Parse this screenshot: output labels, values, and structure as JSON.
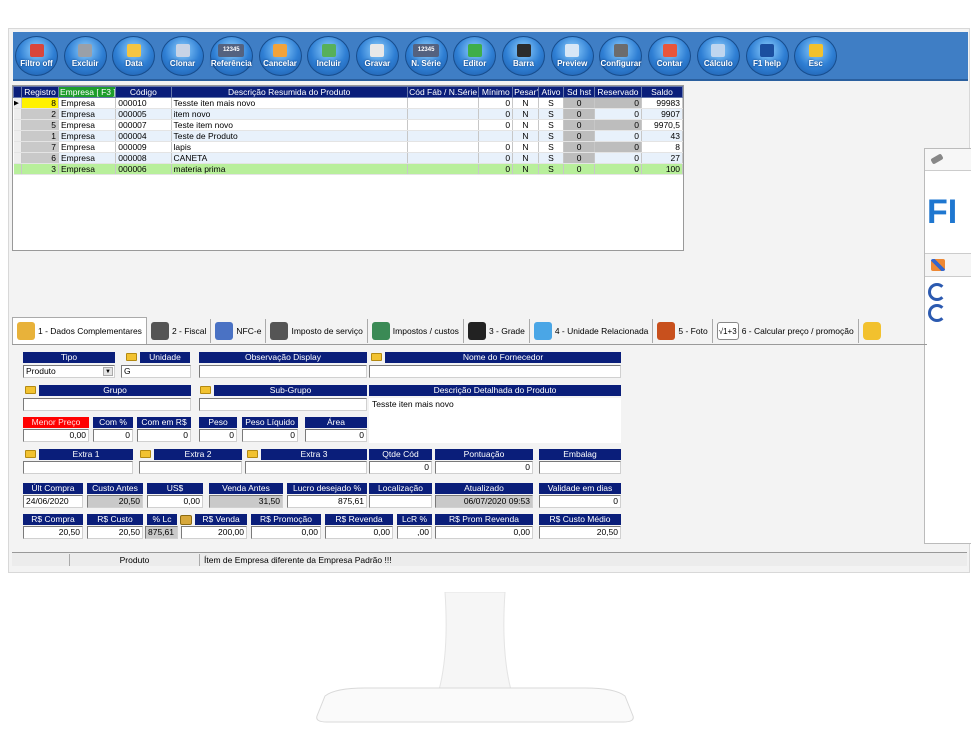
{
  "toolbar": {
    "buttons": [
      {
        "label": "Filtro off",
        "icon": "filter-icon"
      },
      {
        "label": "Excluir",
        "icon": "trash-icon"
      },
      {
        "label": "Data",
        "icon": "calendar-icon"
      },
      {
        "label": "Clonar",
        "icon": "clone-icon"
      },
      {
        "label": "Referência",
        "icon": "barcode-number-icon"
      },
      {
        "label": "Cancelar",
        "icon": "undo-icon"
      },
      {
        "label": "Incluir",
        "icon": "add-check-icon"
      },
      {
        "label": "Gravar",
        "icon": "save-icon"
      },
      {
        "label": "N. Série",
        "icon": "serial-number-icon"
      },
      {
        "label": "Editor",
        "icon": "pencil-icon"
      },
      {
        "label": "Barra",
        "icon": "barcode-icon"
      },
      {
        "label": "Preview",
        "icon": "printer-icon"
      },
      {
        "label": "Configurar",
        "icon": "gear-icon"
      },
      {
        "label": "Contar",
        "icon": "count-icon"
      },
      {
        "label": "Cálculo",
        "icon": "calculator-icon"
      },
      {
        "label": "F1 help",
        "icon": "help-icon"
      },
      {
        "label": "Esc",
        "icon": "exit-runner-icon"
      }
    ],
    "icon_number_text": "12345"
  },
  "grid": {
    "columns": [
      "Registro",
      "Empresa [ F3 ]",
      "Código",
      "Descrição Resumida do Produto",
      "Cód Fáb / N.Série",
      "Mínimo",
      "Pesar?",
      "Ativo",
      "Sd hst",
      "Reservado",
      "Saldo"
    ],
    "rows": [
      {
        "registro": "8",
        "empresa": "Empresa",
        "codigo": "000010",
        "descricao": "Tesste iten mais novo",
        "codfab": "",
        "minimo": "0",
        "pesar": "N",
        "ativo": "S",
        "sdhst": "0",
        "reservado": "0",
        "saldo": "99983"
      },
      {
        "registro": "2",
        "empresa": "Empresa",
        "codigo": "000005",
        "descricao": "item novo",
        "codfab": "",
        "minimo": "0",
        "pesar": "N",
        "ativo": "S",
        "sdhst": "0",
        "reservado": "0",
        "saldo": "9907"
      },
      {
        "registro": "5",
        "empresa": "Empresa",
        "codigo": "000007",
        "descricao": "Teste item novo",
        "codfab": "",
        "minimo": "0",
        "pesar": "N",
        "ativo": "S",
        "sdhst": "0",
        "reservado": "0",
        "saldo": "9970,5"
      },
      {
        "registro": "1",
        "empresa": "Empresa",
        "codigo": "000004",
        "descricao": "Teste de Produto",
        "codfab": "",
        "minimo": "",
        "pesar": "N",
        "ativo": "S",
        "sdhst": "0",
        "reservado": "0",
        "saldo": "43"
      },
      {
        "registro": "7",
        "empresa": "Empresa",
        "codigo": "000009",
        "descricao": "lapis",
        "codfab": "",
        "minimo": "0",
        "pesar": "N",
        "ativo": "S",
        "sdhst": "0",
        "reservado": "0",
        "saldo": "8"
      },
      {
        "registro": "6",
        "empresa": "Empresa",
        "codigo": "000008",
        "descricao": "CANETA",
        "codfab": "",
        "minimo": "0",
        "pesar": "N",
        "ativo": "S",
        "sdhst": "0",
        "reservado": "0",
        "saldo": "27"
      },
      {
        "registro": "3",
        "empresa": "Empresa",
        "codigo": "000006",
        "descricao": "materia prima",
        "codfab": "",
        "minimo": "0",
        "pesar": "N",
        "ativo": "S",
        "sdhst": "0",
        "reservado": "0",
        "saldo": "100"
      }
    ]
  },
  "tabs": [
    {
      "label": "1 - Dados Complementares",
      "icon": "pencil-ruler-icon"
    },
    {
      "label": "2 - Fiscal",
      "icon": "gears-icon"
    },
    {
      "label": "NFC-e",
      "icon": "document-icon"
    },
    {
      "label": "Imposto de serviço",
      "icon": "gears-icon"
    },
    {
      "label": "Impostos / custos",
      "icon": "magnifier-icon"
    },
    {
      "label": "3 - Grade",
      "icon": "shirt-icon"
    },
    {
      "label": "4 - Unidade Relacionada",
      "icon": "colorful-icon"
    },
    {
      "label": "5 - Foto",
      "icon": "photo-icon"
    },
    {
      "label": "6 - Calcular preço / promoção",
      "icon": "sqrt-icon"
    }
  ],
  "sqrt_icon_text": "√1+3",
  "form": {
    "tipo": {
      "label": "Tipo",
      "value": "Produto"
    },
    "unidade": {
      "label": "Unidade",
      "value": "G"
    },
    "observacao": {
      "label": "Observação Display",
      "value": ""
    },
    "fornecedor": {
      "label": "Nome do Fornecedor",
      "value": ""
    },
    "grupo": {
      "label": "Grupo",
      "value": ""
    },
    "subgrupo": {
      "label": "Sub-Grupo",
      "value": ""
    },
    "descricao_detalhada": {
      "label": "Descrição Detalhada do Produto",
      "value": "Tesste iten mais novo"
    },
    "menor_preco": {
      "label": "Menor Preço",
      "value": "0,00"
    },
    "com_pct": {
      "label": "Com %",
      "value": "0"
    },
    "com_rs": {
      "label": "Com em R$",
      "value": "0"
    },
    "peso": {
      "label": "Peso",
      "value": "0"
    },
    "peso_liquido": {
      "label": "Peso Líquido",
      "value": "0"
    },
    "area": {
      "label": "Área",
      "value": "0"
    },
    "extra1": {
      "label": "Extra 1",
      "value": ""
    },
    "extra2": {
      "label": "Extra 2",
      "value": ""
    },
    "extra3": {
      "label": "Extra 3",
      "value": ""
    },
    "qtde_cod": {
      "label": "Qtde Cód",
      "value": "0"
    },
    "pontuacao": {
      "label": "Pontuação",
      "value": "0"
    },
    "embalag": {
      "label": "Embalag",
      "value": ""
    },
    "ult_compra": {
      "label": "Últ Compra",
      "value": "24/06/2020"
    },
    "custo_antes": {
      "label": "Custo Antes",
      "value": "20,50"
    },
    "us": {
      "label": "US$",
      "value": "0,00"
    },
    "venda_antes": {
      "label": "Venda Antes",
      "value": "31,50"
    },
    "lucro": {
      "label": "Lucro desejado %",
      "value": "875,61"
    },
    "localizacao": {
      "label": "Localização",
      "value": ""
    },
    "atualizado": {
      "label": "Atualizado",
      "value": "06/07/2020 09:53"
    },
    "validade": {
      "label": "Validade em dias",
      "value": "0"
    },
    "rs_compra": {
      "label": "R$ Compra",
      "value": "20,50"
    },
    "rs_custo": {
      "label": "R$ Custo",
      "value": "20,50"
    },
    "pct_lc": {
      "label": "% Lc",
      "value": "875,61"
    },
    "rs_venda": {
      "label": "R$ Venda",
      "value": "200,00"
    },
    "rs_promocao": {
      "label": "R$ Promoção",
      "value": "0,00"
    },
    "rs_revenda": {
      "label": "R$ Revenda",
      "value": "0,00"
    },
    "lcr_pct": {
      "label": "LcR %",
      "value": ",00"
    },
    "rs_prom_revenda": {
      "label": "R$ Prom Revenda",
      "value": "0,00"
    },
    "rs_custo_medio": {
      "label": "R$ Custo Médio",
      "value": "20,50"
    }
  },
  "status": {
    "left": "",
    "entity": "Produto",
    "message": "Ítem de Empresa diferente da Empresa Padrão !!!"
  },
  "side_window": {
    "logo_text": "FI"
  },
  "colors": {
    "toolbar": "#3f7ec5",
    "header": "#0a1e7a",
    "selected_row": "#b8ef9b",
    "current_cell": "#fff200",
    "alert": "#ff0000"
  }
}
